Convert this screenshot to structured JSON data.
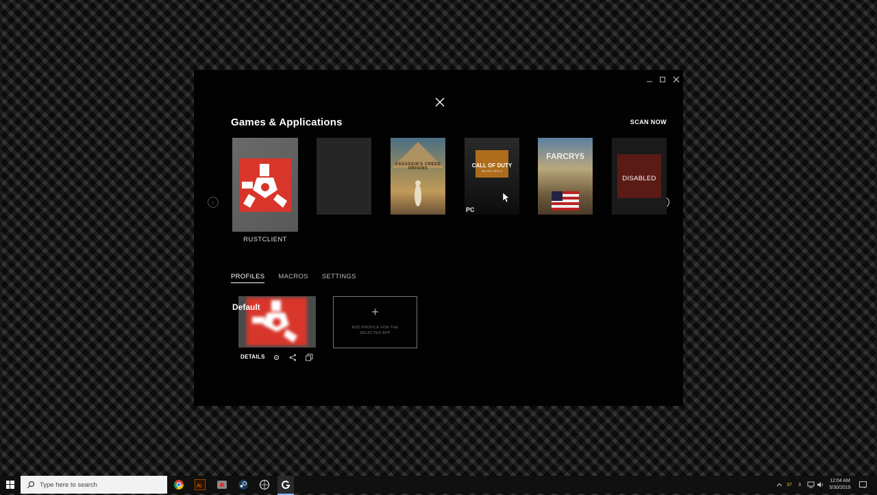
{
  "window": {
    "minimize_glyph": "‗",
    "maximize_glyph": "□",
    "close_glyph": "✕"
  },
  "header": {
    "title": "Games & Applications",
    "scan_label": "SCAN NOW"
  },
  "carousel": {
    "prev_glyph": "‹",
    "next_glyph": "›",
    "items": [
      {
        "label": "RUSTCLIENT",
        "selected": true
      },
      {
        "label": "",
        "art": "blank"
      },
      {
        "label": "",
        "art_text": "ASSASSIN'S CREED ORIGINS"
      },
      {
        "label": "",
        "art_text": "CALL OF DUTY",
        "art_sub": "BLACK OPS 4",
        "badge": "PC"
      },
      {
        "label": "",
        "art_text": "FARCRY5"
      },
      {
        "label": "",
        "overlay": "DISABLED"
      }
    ]
  },
  "tabs": [
    "PROFILES",
    "MACROS",
    "SETTINGS"
  ],
  "active_tab": "PROFILES",
  "profiles": {
    "default_name": "Default",
    "details_label": "DETAILS",
    "add_label": "ADD PROFILE FOR THE SELECTED APP",
    "add_glyph": "+"
  },
  "taskbar": {
    "search_placeholder": "Type here to search",
    "time": "12:04 AM",
    "date": "5/30/2019",
    "tray_temp": "37",
    "tray_count": "3"
  },
  "colors": {
    "accent_red": "#d8362b",
    "panel_bg": "#020202",
    "taskbar_bg": "#101010"
  }
}
